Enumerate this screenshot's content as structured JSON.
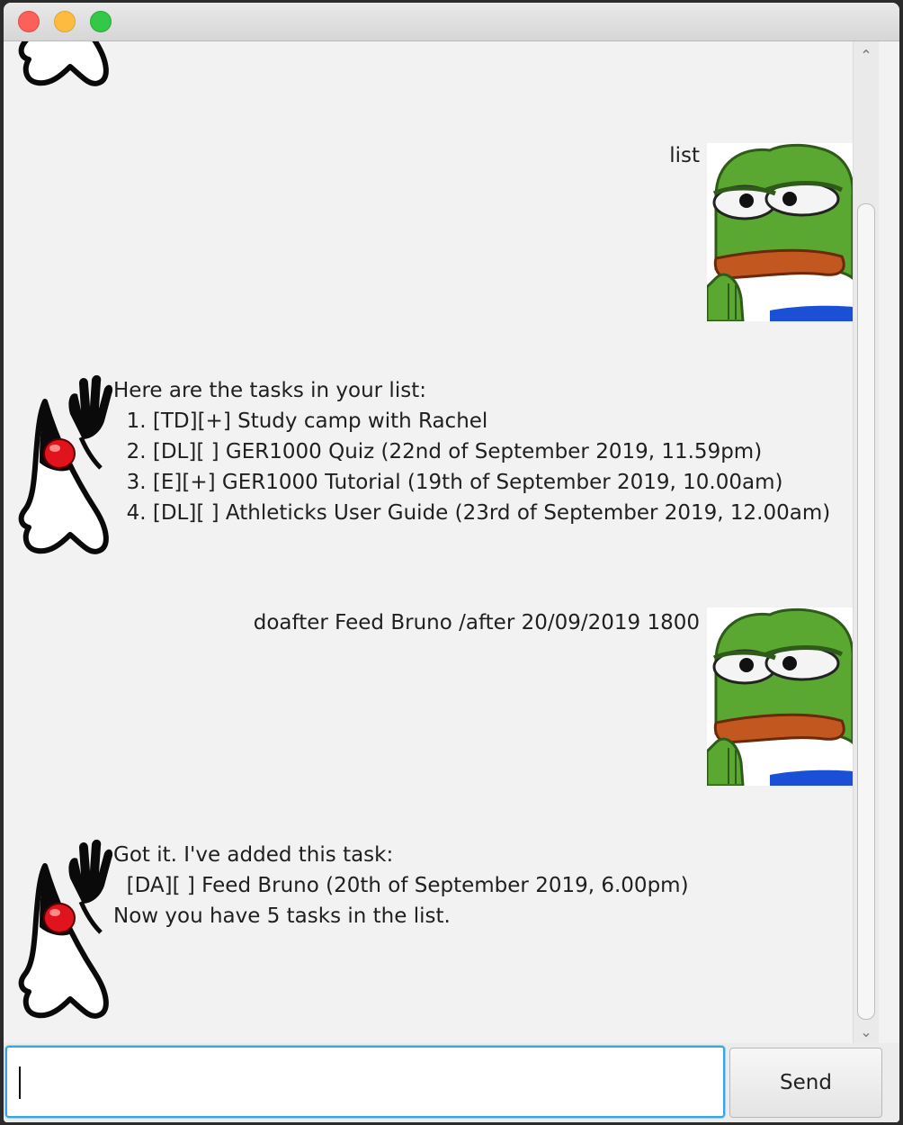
{
  "window": {
    "controls": [
      "close",
      "minimize",
      "maximize"
    ]
  },
  "dialog": [
    {
      "speaker": "user",
      "text": "list"
    },
    {
      "speaker": "duke",
      "lines": [
        "Here are the tasks in your list:",
        "  1. [TD][+] Study camp with Rachel",
        "  2. [DL][ ] GER1000 Quiz (22nd of September 2019, 11.59pm)",
        "  3. [E][+] GER1000 Tutorial (19th of September 2019, 10.00am)",
        "  4. [DL][ ] Athleticks User Guide (23rd of September 2019, 12.00am)"
      ]
    },
    {
      "speaker": "user",
      "text": "doafter Feed Bruno /after 20/09/2019 1800"
    },
    {
      "speaker": "duke",
      "lines": [
        "Got it. I've added this task:",
        "  [DA][ ] Feed Bruno (20th of September 2019, 6.00pm)",
        "Now you have 5 tasks in the list."
      ]
    }
  ],
  "input": {
    "value": "",
    "send_label": "Send"
  },
  "icons": {
    "user_avatar": "frog-avatar-icon",
    "bot_avatar": "duke-mascot-icon",
    "scroll_up": "chevron-up-icon",
    "scroll_down": "chevron-down-icon"
  },
  "colors": {
    "close": "#fc605b",
    "minimize": "#fdbc40",
    "maximize": "#34c84a",
    "focus_border": "#3aa3e3"
  }
}
